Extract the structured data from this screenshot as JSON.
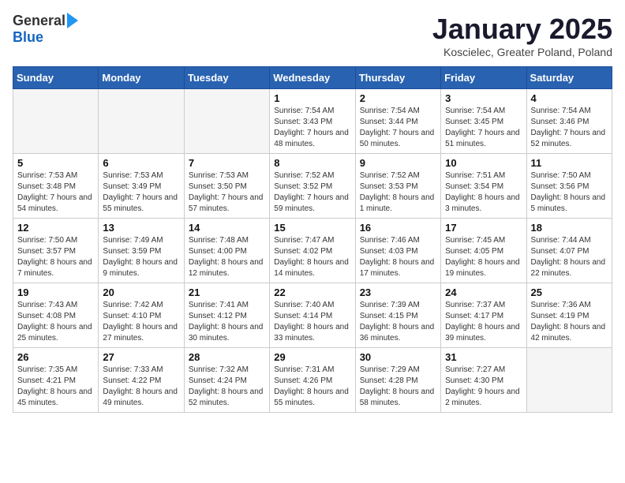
{
  "logo": {
    "general": "General",
    "blue": "Blue"
  },
  "header": {
    "month": "January 2025",
    "location": "Koscielec, Greater Poland, Poland"
  },
  "weekdays": [
    "Sunday",
    "Monday",
    "Tuesday",
    "Wednesday",
    "Thursday",
    "Friday",
    "Saturday"
  ],
  "weeks": [
    [
      {
        "day": "",
        "content": ""
      },
      {
        "day": "",
        "content": ""
      },
      {
        "day": "",
        "content": ""
      },
      {
        "day": "1",
        "content": "Sunrise: 7:54 AM\nSunset: 3:43 PM\nDaylight: 7 hours\nand 48 minutes."
      },
      {
        "day": "2",
        "content": "Sunrise: 7:54 AM\nSunset: 3:44 PM\nDaylight: 7 hours\nand 50 minutes."
      },
      {
        "day": "3",
        "content": "Sunrise: 7:54 AM\nSunset: 3:45 PM\nDaylight: 7 hours\nand 51 minutes."
      },
      {
        "day": "4",
        "content": "Sunrise: 7:54 AM\nSunset: 3:46 PM\nDaylight: 7 hours\nand 52 minutes."
      }
    ],
    [
      {
        "day": "5",
        "content": "Sunrise: 7:53 AM\nSunset: 3:48 PM\nDaylight: 7 hours\nand 54 minutes."
      },
      {
        "day": "6",
        "content": "Sunrise: 7:53 AM\nSunset: 3:49 PM\nDaylight: 7 hours\nand 55 minutes."
      },
      {
        "day": "7",
        "content": "Sunrise: 7:53 AM\nSunset: 3:50 PM\nDaylight: 7 hours\nand 57 minutes."
      },
      {
        "day": "8",
        "content": "Sunrise: 7:52 AM\nSunset: 3:52 PM\nDaylight: 7 hours\nand 59 minutes."
      },
      {
        "day": "9",
        "content": "Sunrise: 7:52 AM\nSunset: 3:53 PM\nDaylight: 8 hours\nand 1 minute."
      },
      {
        "day": "10",
        "content": "Sunrise: 7:51 AM\nSunset: 3:54 PM\nDaylight: 8 hours\nand 3 minutes."
      },
      {
        "day": "11",
        "content": "Sunrise: 7:50 AM\nSunset: 3:56 PM\nDaylight: 8 hours\nand 5 minutes."
      }
    ],
    [
      {
        "day": "12",
        "content": "Sunrise: 7:50 AM\nSunset: 3:57 PM\nDaylight: 8 hours\nand 7 minutes."
      },
      {
        "day": "13",
        "content": "Sunrise: 7:49 AM\nSunset: 3:59 PM\nDaylight: 8 hours\nand 9 minutes."
      },
      {
        "day": "14",
        "content": "Sunrise: 7:48 AM\nSunset: 4:00 PM\nDaylight: 8 hours\nand 12 minutes."
      },
      {
        "day": "15",
        "content": "Sunrise: 7:47 AM\nSunset: 4:02 PM\nDaylight: 8 hours\nand 14 minutes."
      },
      {
        "day": "16",
        "content": "Sunrise: 7:46 AM\nSunset: 4:03 PM\nDaylight: 8 hours\nand 17 minutes."
      },
      {
        "day": "17",
        "content": "Sunrise: 7:45 AM\nSunset: 4:05 PM\nDaylight: 8 hours\nand 19 minutes."
      },
      {
        "day": "18",
        "content": "Sunrise: 7:44 AM\nSunset: 4:07 PM\nDaylight: 8 hours\nand 22 minutes."
      }
    ],
    [
      {
        "day": "19",
        "content": "Sunrise: 7:43 AM\nSunset: 4:08 PM\nDaylight: 8 hours\nand 25 minutes."
      },
      {
        "day": "20",
        "content": "Sunrise: 7:42 AM\nSunset: 4:10 PM\nDaylight: 8 hours\nand 27 minutes."
      },
      {
        "day": "21",
        "content": "Sunrise: 7:41 AM\nSunset: 4:12 PM\nDaylight: 8 hours\nand 30 minutes."
      },
      {
        "day": "22",
        "content": "Sunrise: 7:40 AM\nSunset: 4:14 PM\nDaylight: 8 hours\nand 33 minutes."
      },
      {
        "day": "23",
        "content": "Sunrise: 7:39 AM\nSunset: 4:15 PM\nDaylight: 8 hours\nand 36 minutes."
      },
      {
        "day": "24",
        "content": "Sunrise: 7:37 AM\nSunset: 4:17 PM\nDaylight: 8 hours\nand 39 minutes."
      },
      {
        "day": "25",
        "content": "Sunrise: 7:36 AM\nSunset: 4:19 PM\nDaylight: 8 hours\nand 42 minutes."
      }
    ],
    [
      {
        "day": "26",
        "content": "Sunrise: 7:35 AM\nSunset: 4:21 PM\nDaylight: 8 hours\nand 45 minutes."
      },
      {
        "day": "27",
        "content": "Sunrise: 7:33 AM\nSunset: 4:22 PM\nDaylight: 8 hours\nand 49 minutes."
      },
      {
        "day": "28",
        "content": "Sunrise: 7:32 AM\nSunset: 4:24 PM\nDaylight: 8 hours\nand 52 minutes."
      },
      {
        "day": "29",
        "content": "Sunrise: 7:31 AM\nSunset: 4:26 PM\nDaylight: 8 hours\nand 55 minutes."
      },
      {
        "day": "30",
        "content": "Sunrise: 7:29 AM\nSunset: 4:28 PM\nDaylight: 8 hours\nand 58 minutes."
      },
      {
        "day": "31",
        "content": "Sunrise: 7:27 AM\nSunset: 4:30 PM\nDaylight: 9 hours\nand 2 minutes."
      },
      {
        "day": "",
        "content": ""
      }
    ]
  ]
}
